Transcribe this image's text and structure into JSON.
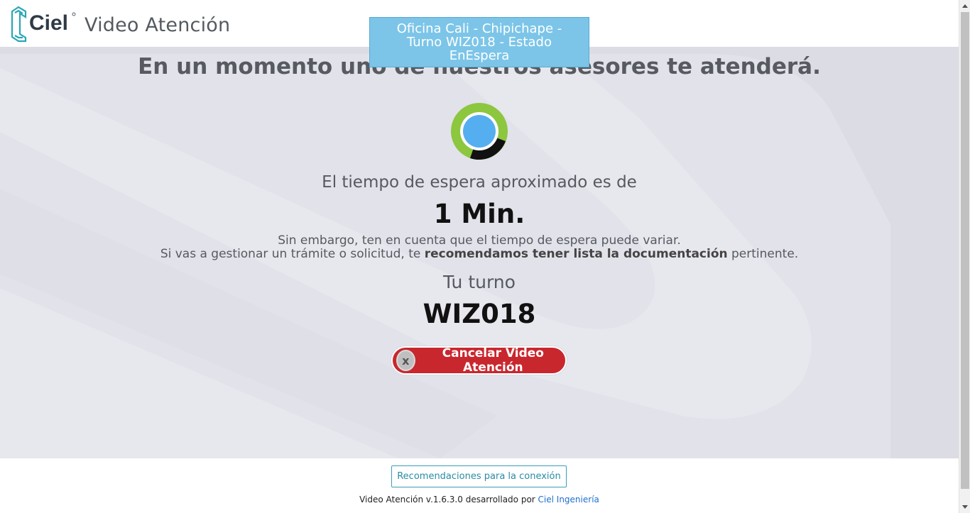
{
  "header": {
    "logo_text": "Ciel",
    "app_title": "Video Atención"
  },
  "status": {
    "text": "Oficina Cali - Chipichape - Turno WIZ018 - Estado EnEspera"
  },
  "main": {
    "headline": "En un momento uno de nuestros asesores te atenderá.",
    "wait_label": "El tiempo de espera aproximado es de",
    "wait_value": "1 Min.",
    "note_line1": "Sin embargo, ten en cuenta que el tiempo de espera puede variar.",
    "note_line2_pre": "Si vas a gestionar un trámite o solicitud, te ",
    "note_line2_bold": "recomendamos tener lista la documentación",
    "note_line2_post": " pertinente.",
    "turno_label": "Tu turno",
    "turno_value": "WIZ018",
    "cancel_label": "Cancelar Video Atención",
    "cancel_icon_glyph": "x"
  },
  "footer": {
    "recommendations_label": "Recomendaciones para la conexión",
    "credits_prefix": "Video Atención v.1.6.3.0 desarrollado por ",
    "credits_link": "Ciel Ingeniería"
  },
  "colors": {
    "accent_blue": "#7cc5e8",
    "cancel_red": "#c9272e",
    "spinner_green": "#8dc63f",
    "spinner_inner": "#55aef0",
    "link_blue": "#1f6fd1"
  },
  "icons": {
    "logo": "ciel-logo-icon",
    "spinner": "loading-spinner-icon",
    "cancel": "close-icon"
  }
}
